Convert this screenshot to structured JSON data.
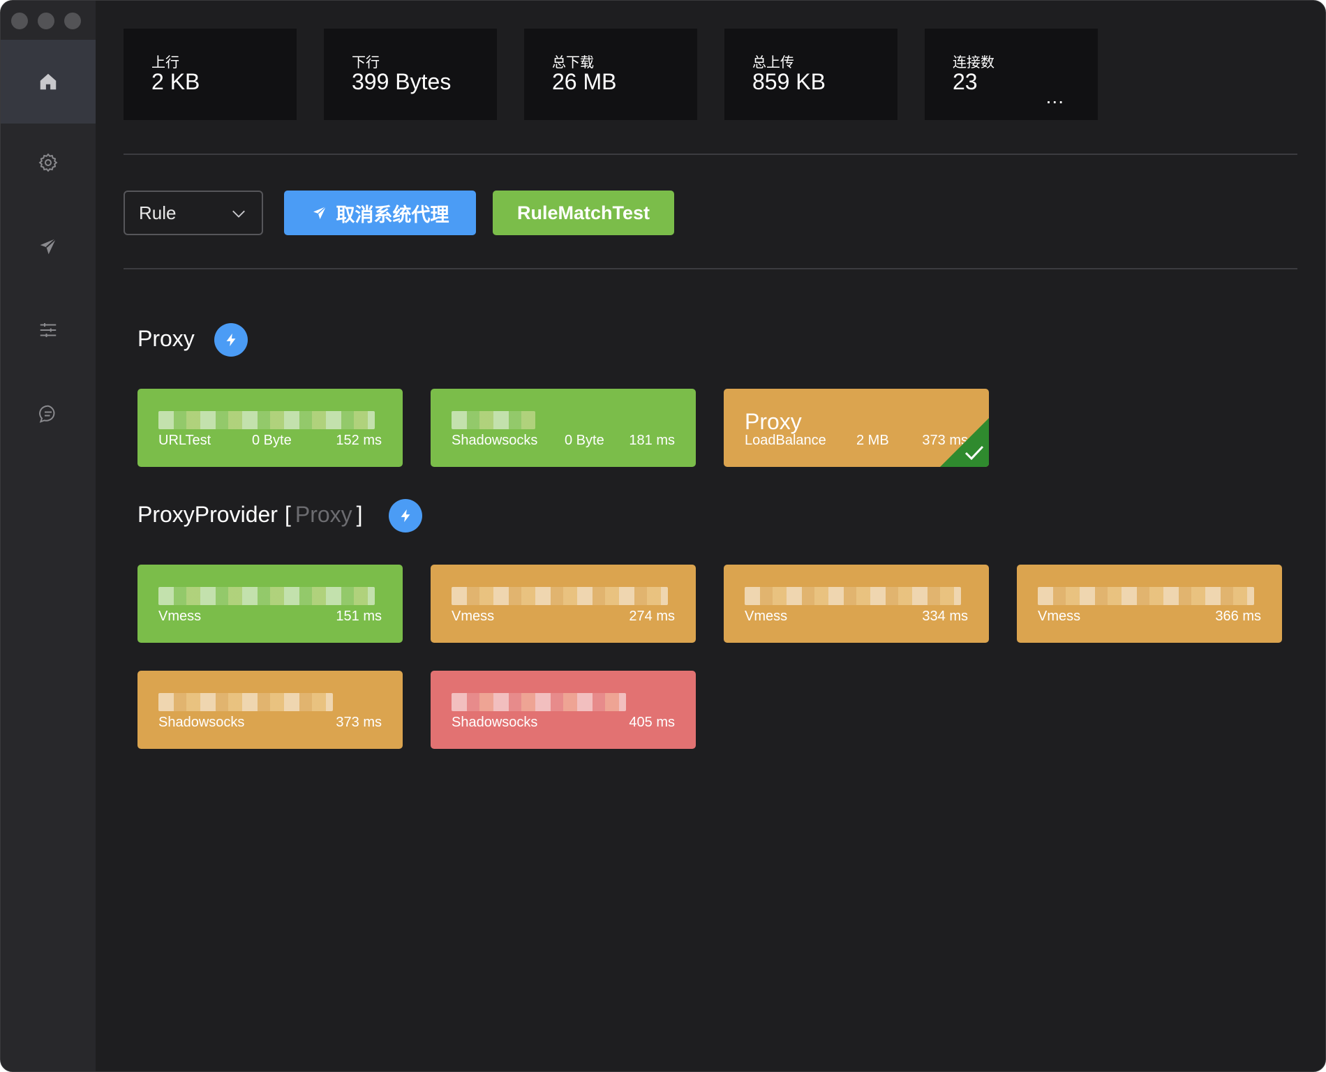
{
  "stats": [
    {
      "label": "上行",
      "value": "2 KB"
    },
    {
      "label": "下行",
      "value": "399 Bytes"
    },
    {
      "label": "总下载",
      "value": "26 MB"
    },
    {
      "label": "总上传",
      "value": "859 KB"
    },
    {
      "label": "连接数",
      "value": "23",
      "more": "..."
    }
  ],
  "toolbar": {
    "mode": "Rule",
    "system_proxy_button": "取消系统代理",
    "rule_test_button": "RuleMatchTest"
  },
  "sections": {
    "proxy": {
      "title": "Proxy"
    },
    "provider": {
      "title": "ProxyProvider",
      "bracket_open": "[",
      "subtitle": "Proxy",
      "bracket_close": "]"
    }
  },
  "proxy_cards": [
    {
      "name": "",
      "type": "URLTest",
      "traffic": "0 Byte",
      "delay": "152 ms",
      "color": "#7bbd4a"
    },
    {
      "name": "",
      "type": "Shadowsocks",
      "traffic": "0 Byte",
      "delay": "181 ms",
      "color": "#7bbd4a"
    },
    {
      "name": "Proxy",
      "type": "LoadBalance",
      "traffic": "2 MB",
      "delay": "373 ms",
      "color": "#dba44f",
      "selected": true
    }
  ],
  "provider_cards": [
    {
      "type": "Vmess",
      "delay": "151 ms",
      "color": "#7bbd4a"
    },
    {
      "type": "Vmess",
      "delay": "274 ms",
      "color": "#dba44f"
    },
    {
      "type": "Vmess",
      "delay": "334 ms",
      "color": "#dba44f"
    },
    {
      "type": "Vmess",
      "delay": "366 ms",
      "color": "#dba44f"
    },
    {
      "type": "Shadowsocks",
      "delay": "373 ms",
      "color": "#dba44f"
    },
    {
      "type": "Shadowsocks",
      "delay": "405 ms",
      "color": "#e27272"
    }
  ],
  "icons": {
    "nav": [
      "home-icon",
      "gear-icon",
      "paper-plane-icon",
      "sliders-icon",
      "chat-icon"
    ],
    "bolt": "lightning-icon",
    "check": "check-icon"
  }
}
